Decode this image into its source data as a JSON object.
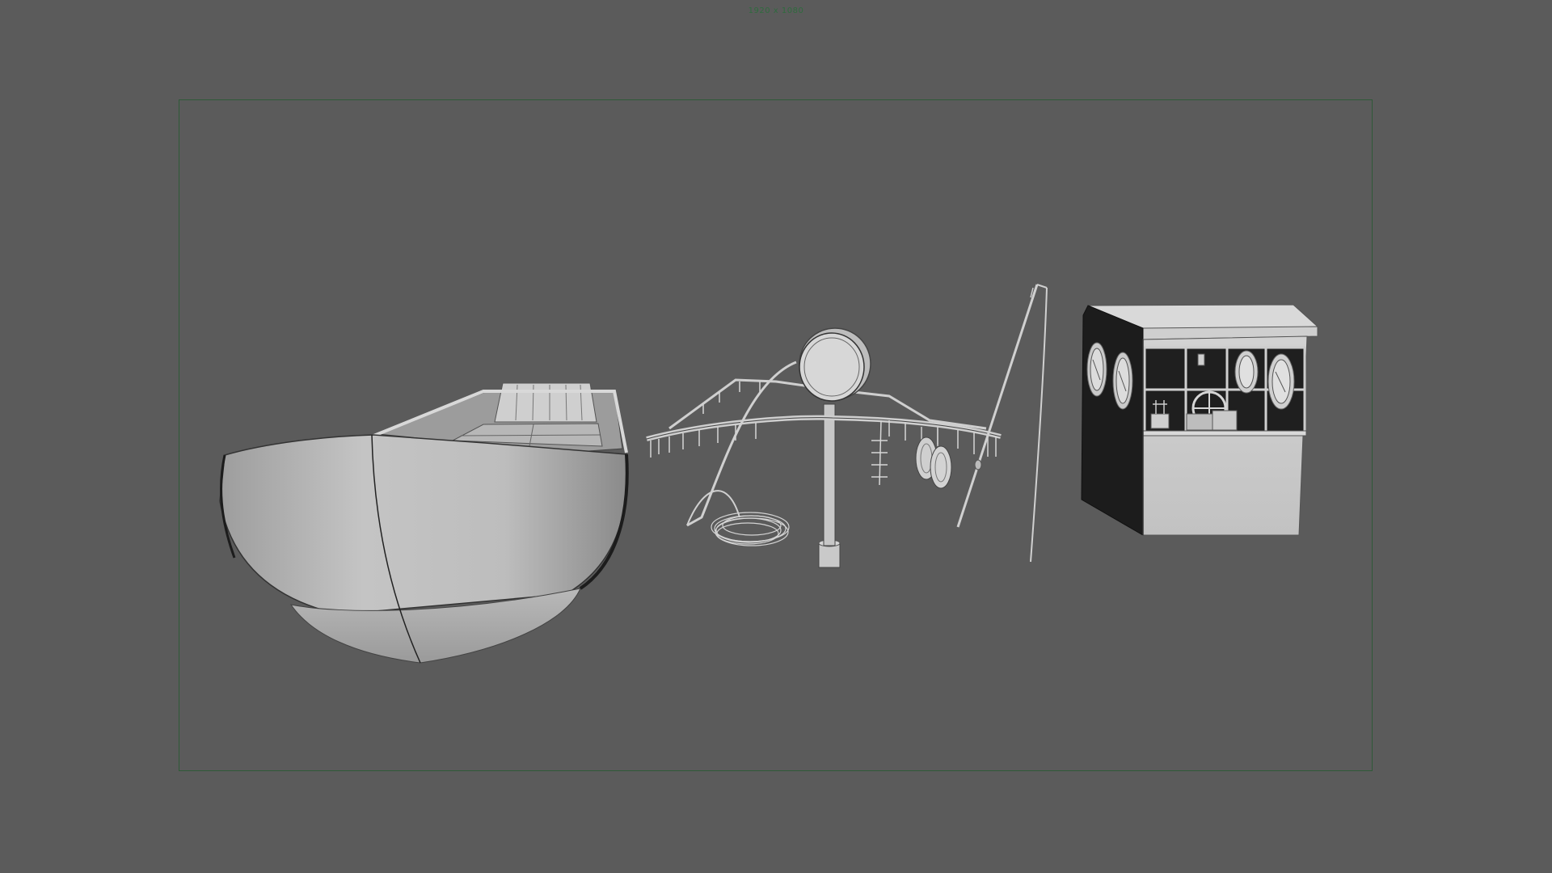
{
  "viewport": {
    "resolution_label": "1920 x 1080"
  },
  "colors": {
    "background": "#5b5b5b",
    "gate_border": "#2f5a38",
    "label": "#2f6b3e",
    "model_light": "#c8c8c8",
    "model_mid": "#a9a9a9",
    "model_dark": "#1a1a1a",
    "edge": "#3a3a3a"
  },
  "scene": {
    "objects": [
      {
        "name": "boat-hull",
        "icon": "boat-icon"
      },
      {
        "name": "mast-rig",
        "icon": "mast-icon"
      },
      {
        "name": "fishing-rod",
        "icon": "rod-icon"
      },
      {
        "name": "wheelhouse-cabin",
        "icon": "cabin-icon"
      }
    ]
  }
}
